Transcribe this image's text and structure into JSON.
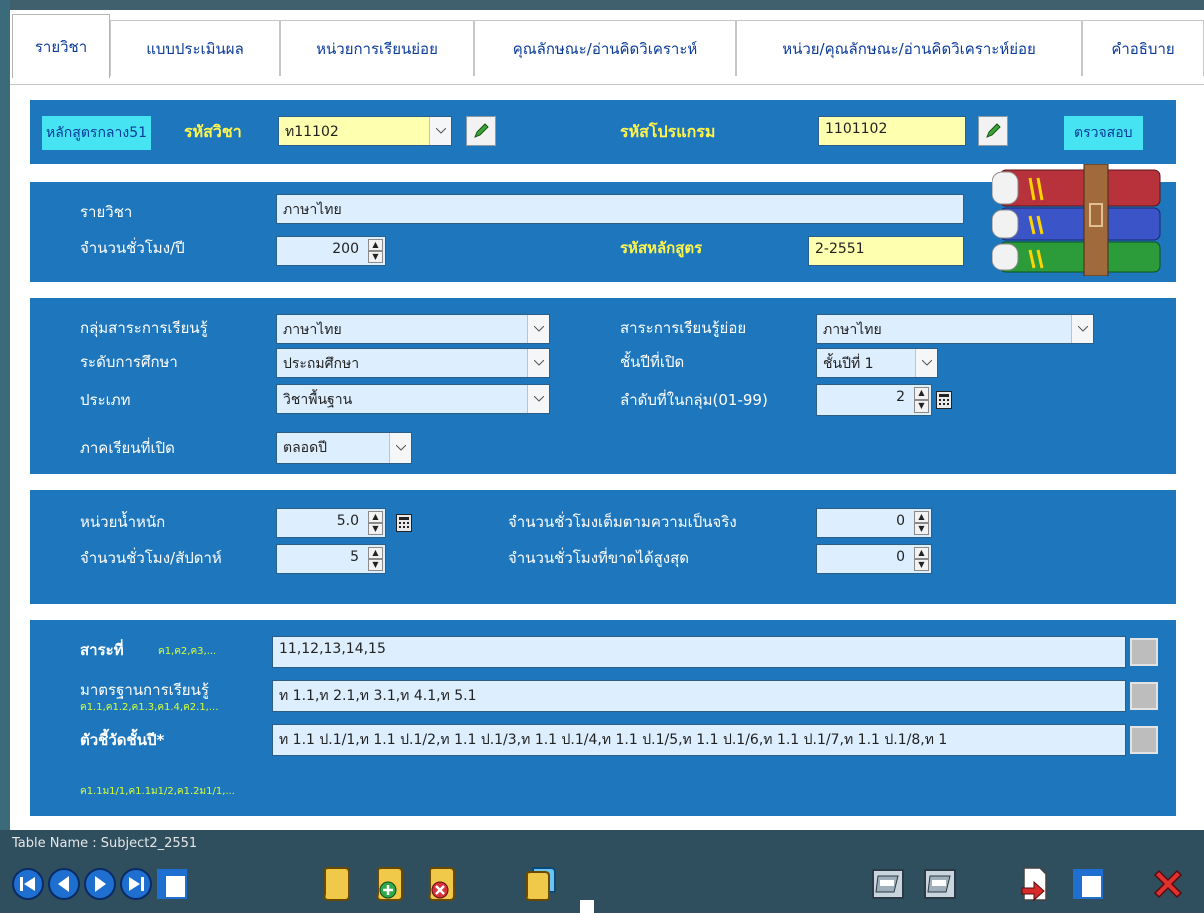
{
  "tabs": [
    {
      "label": "รายวิชา"
    },
    {
      "label": "แบบประเมินผล"
    },
    {
      "label": "หน่วยการเรียนย่อย"
    },
    {
      "label": "คุณลักษณะ/อ่านคิดวิเคราะห์"
    },
    {
      "label": "หน่วย/คุณลักษณะ/อ่านคิดวิเคราะห์ย่อย"
    },
    {
      "label": "คำอธิบาย"
    }
  ],
  "header": {
    "curriculum_badge": "หลักสูตรกลาง51",
    "subject_code_label": "รหัสวิชา",
    "subject_code_value": "ท11102",
    "program_code_label": "รหัสโปรแกรม",
    "program_code_value": "1101102",
    "check_button": "ตรวจสอบ"
  },
  "subject": {
    "name_label": "รายวิชา",
    "name_value": "ภาษาไทย",
    "hours_year_label": "จำนวนชั่วโมง/ปี",
    "hours_year_value": "200",
    "curriculum_code_label": "รหัสหลักสูตร",
    "curriculum_code_value": "2-2551"
  },
  "classification": {
    "learning_area_label": "กลุ่มสาระการเรียนรู้",
    "learning_area_value": "ภาษาไทย",
    "sub_area_label": "สาระการเรียนรู้ย่อย",
    "sub_area_value": "ภาษาไทย",
    "level_label": "ระดับการศึกษา",
    "level_value": "ประถมศึกษา",
    "grade_label": "ชั้นปีที่เปิด",
    "grade_value": "ชั้นปีที่ 1",
    "type_label": "ประเภท",
    "type_value": "วิชาพื้นฐาน",
    "order_label": "ลำดับที่ในกลุ่ม(01-99)",
    "order_value": "2",
    "semester_label": "ภาคเรียนที่เปิด",
    "semester_value": "ตลอดปี"
  },
  "weights": {
    "credit_label": "หน่วยน้ำหนัก",
    "credit_value": "5.0",
    "hours_week_label": "จำนวนชั่วโมง/สัปดาห์",
    "hours_week_value": "5",
    "full_hours_label": "จำนวนชั่วโมงเต็มตามความเป็นจริง",
    "full_hours_value": "0",
    "max_absent_label": "จำนวนชั่วโมงที่ขาดได้สูงสุด",
    "max_absent_value": "0"
  },
  "standards": {
    "strand_label": "สาระที่",
    "strand_hint": "ค1,ค2,ค3,...",
    "strand_value": "11,12,13,14,15",
    "standard_label": "มาตรฐานการเรียนรู้",
    "standard_hint": "ค1.1,ค1.2,ค1.3,ค1.4,ค2.1,...",
    "standard_value": "ท 1.1,ท 2.1,ท 3.1,ท 4.1,ท 5.1",
    "indicator_label": "ตัวชี้วัดชั้นปี*",
    "indicator_value": "ท 1.1 ป.1/1,ท 1.1 ป.1/2,ท 1.1 ป.1/3,ท 1.1 ป.1/4,ท 1.1 ป.1/5,ท 1.1 ป.1/6,ท 1.1 ป.1/7,ท 1.1 ป.1/8,ท 1",
    "indicator_hint": "ค1.1ม1/1,ค1.1ม1/2,ค1.2ม1/1,..."
  },
  "status": {
    "table_name": "Table Name : Subject2_2551"
  },
  "colors": {
    "panel": "#1e77bd",
    "label_yellow": "#fff54a",
    "field_blue": "#ddeeff",
    "field_yellow": "#ffffb0",
    "status_bar": "#2f4f5f"
  }
}
